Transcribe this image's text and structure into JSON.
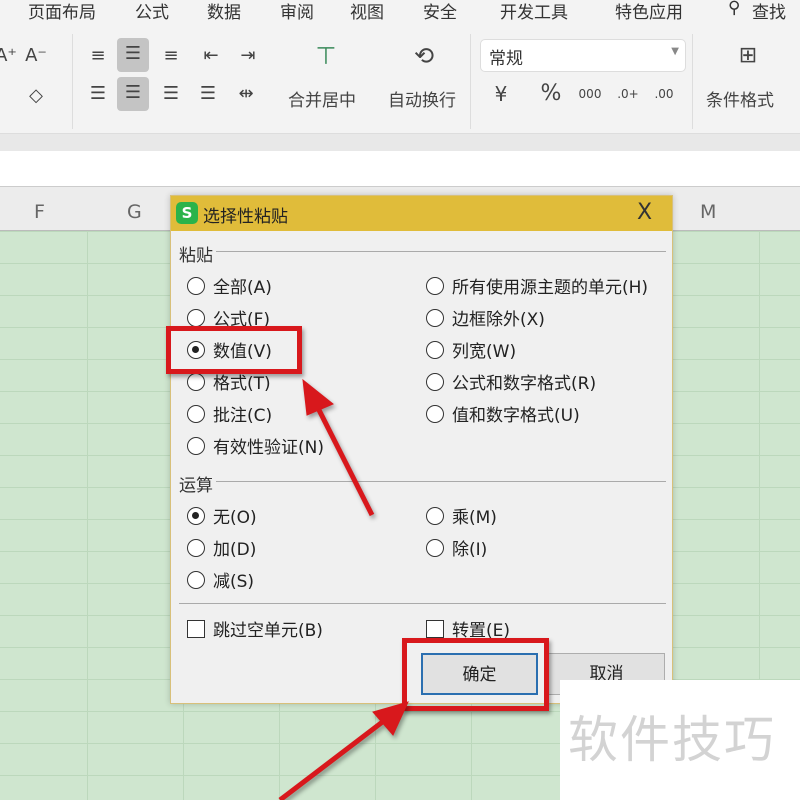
{
  "menu": [
    "页面布局",
    "公式",
    "数据",
    "审阅",
    "视图",
    "安全",
    "开发工具",
    "特色应用",
    "查找命"
  ],
  "ribbon": {
    "merge_center": "合并居中",
    "auto_wrap": "自动换行",
    "number_format": "常规",
    "conditional_format": "条件格式",
    "percent": "%",
    "thousands": "000",
    "inc_decimal": ".0+",
    "dec_decimal": ".00"
  },
  "columns": [
    "F",
    "G",
    "M"
  ],
  "dialog": {
    "title": "选择性粘贴",
    "close": "X",
    "paste_label": "粘贴",
    "paste_options": [
      "全部(A)",
      "公式(F)",
      "数值(V)",
      "格式(T)",
      "批注(C)",
      "有效性验证(N)"
    ],
    "paste_options_right": [
      "所有使用源主题的单元(H)",
      "边框除外(X)",
      "列宽(W)",
      "公式和数字格式(R)",
      "值和数字格式(U)"
    ],
    "selected_paste": "数值(V)",
    "operation_label": "运算",
    "operation_options": [
      "无(O)",
      "加(D)",
      "减(S)"
    ],
    "operation_options_right": [
      "乘(M)",
      "除(I)"
    ],
    "selected_operation": "无(O)",
    "skip_blanks": "跳过空单元(B)",
    "transpose": "转置(E)",
    "ok": "确定",
    "cancel": "取消"
  },
  "watermark": "软件技巧",
  "colors": {
    "title_bar": "#e0bc3a",
    "annotation": "#d8181c",
    "grid": "#cfe6cf"
  }
}
